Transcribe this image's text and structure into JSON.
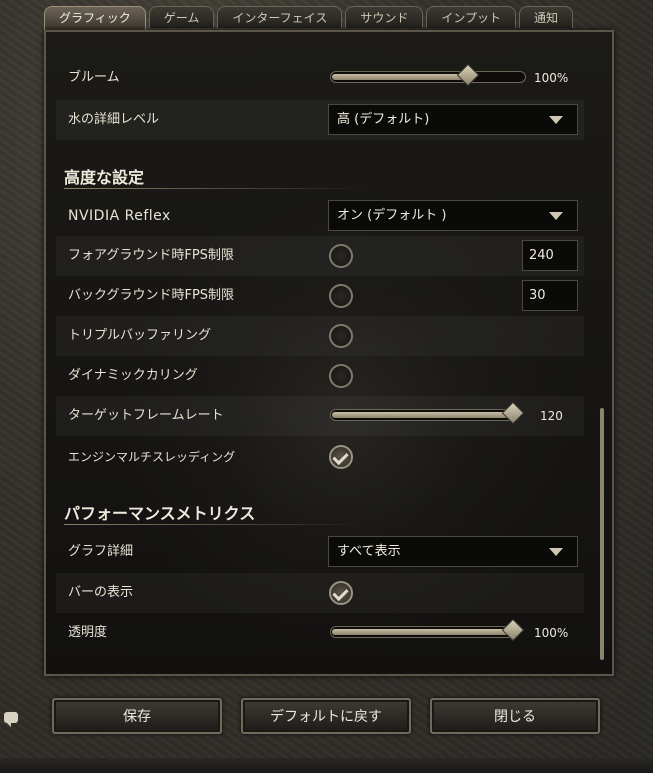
{
  "tabs": [
    {
      "label": "グラフィック",
      "active": true
    },
    {
      "label": "ゲーム",
      "active": false
    },
    {
      "label": "インターフェイス",
      "active": false
    },
    {
      "label": "サウンド",
      "active": false
    },
    {
      "label": "インプット",
      "active": false
    },
    {
      "label": "通知",
      "active": false
    }
  ],
  "settings": {
    "bloom": {
      "label": "ブルーム",
      "value": "100%",
      "level": 0.7
    },
    "water_detail": {
      "label": "水の詳細レベル",
      "value": "高 (デフォルト)"
    },
    "advanced_title": "高度な設定",
    "nvidia_reflex": {
      "label": "NVIDIA Reflex",
      "value": "オン (デフォルト )"
    },
    "fg_fps_limit": {
      "label": "フォアグラウンド時FPS制限",
      "enabled": false,
      "value": "240"
    },
    "bg_fps_limit": {
      "label": "バックグラウンド時FPS制限",
      "enabled": false,
      "value": "30"
    },
    "triple_buffering": {
      "label": "トリプルバッファリング",
      "enabled": false
    },
    "dynamic_culling": {
      "label": "ダイナミックカリング",
      "enabled": false
    },
    "target_framerate": {
      "label": "ターゲットフレームレート",
      "value": "120",
      "level": 0.96
    },
    "engine_multithreading": {
      "label": "エンジンマルチスレッディング",
      "enabled": true
    },
    "metrics_title": "パフォーマンスメトリクス",
    "graph_detail": {
      "label": "グラフ詳細",
      "value": "すべて表示"
    },
    "show_bar": {
      "label": "バーの表示",
      "enabled": true
    },
    "opacity": {
      "label": "透明度",
      "value": "100%",
      "level": 0.96
    }
  },
  "buttons": {
    "save": "保存",
    "reset_default": "デフォルトに戻す",
    "close": "閉じる"
  },
  "icons": {
    "dropdown": "chevron-down-icon",
    "check": "checkmark-icon",
    "chat": "chat-icon"
  },
  "colors": {
    "panel_bg": "#141311",
    "frame": "#35322c",
    "accent": "#c9bfa6"
  }
}
